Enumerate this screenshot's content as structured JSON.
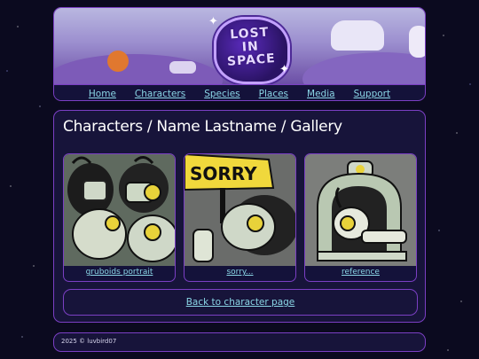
{
  "header": {
    "logo_alt": "Lost in Space",
    "nav": [
      {
        "label": "Home"
      },
      {
        "label": "Characters"
      },
      {
        "label": "Species"
      },
      {
        "label": "Places"
      },
      {
        "label": "Media"
      },
      {
        "label": "Support"
      }
    ]
  },
  "main": {
    "title": "Characters / Name Lastname / Gallery",
    "gallery": [
      {
        "caption": "gruboids portrait",
        "image": "robot-group-illustration"
      },
      {
        "caption": "sorry...",
        "image": "robot-sorry-sign-illustration",
        "sign_text": "SORRY"
      },
      {
        "caption": "reference",
        "image": "robot-reference-illustration"
      }
    ],
    "back_link": "Back to character page"
  },
  "footer": {
    "copyright": "2025 © luvbird07"
  },
  "colors": {
    "background": "#0b0a1f",
    "panel": "#17143a",
    "border": "#7b3fc4",
    "link": "#8ad6e6",
    "text": "#ffffff"
  }
}
